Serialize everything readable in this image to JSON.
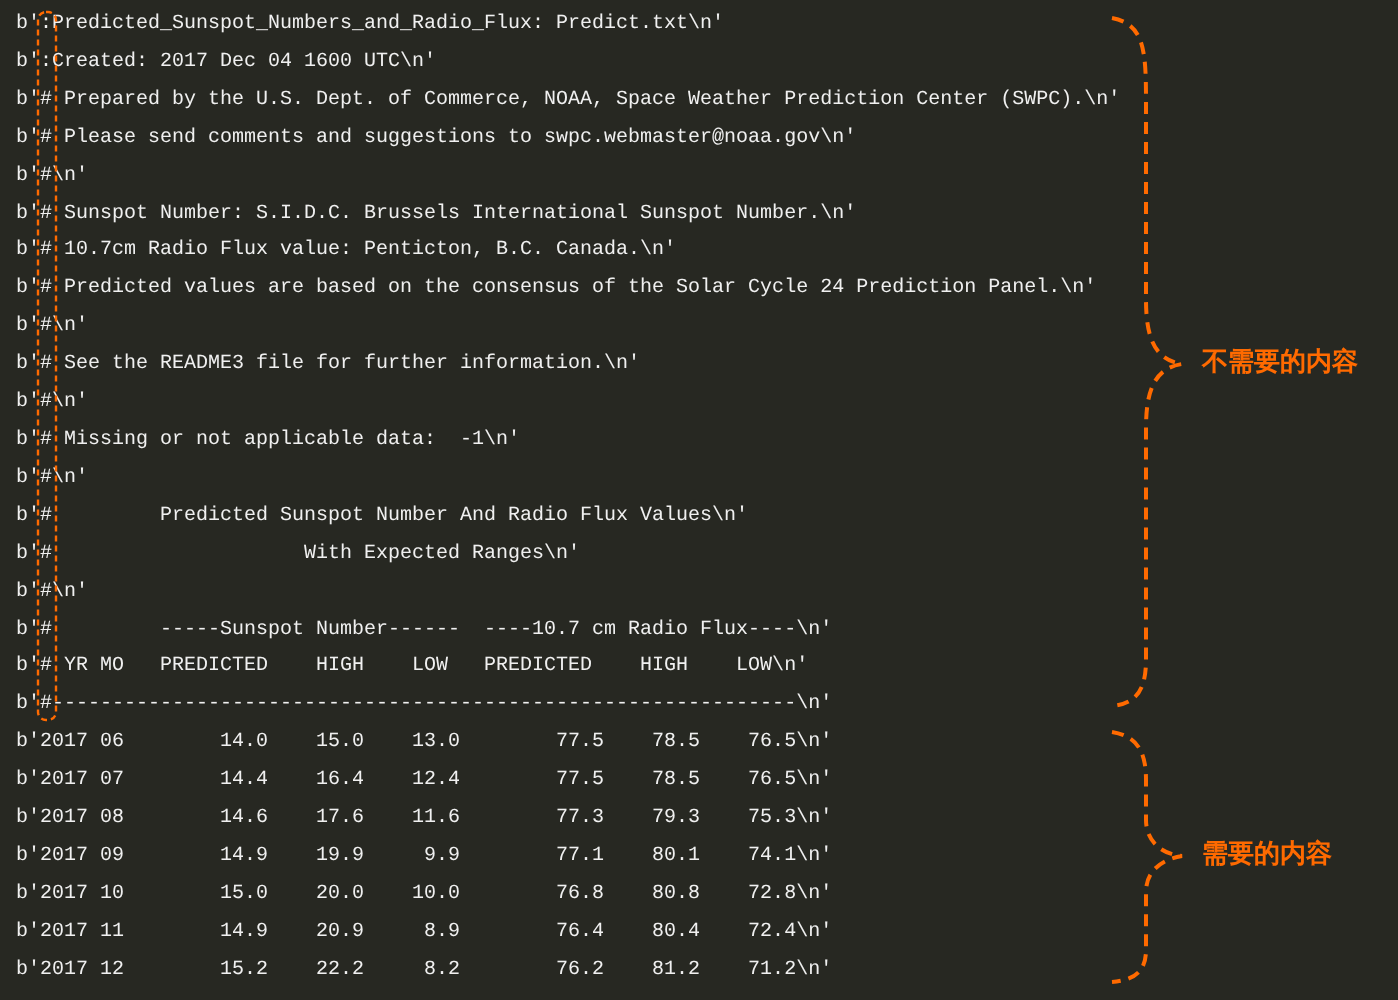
{
  "header_lines": [
    "b':Predicted_Sunspot_Numbers_and_Radio_Flux: Predict.txt\\n'",
    "b':Created: 2017 Dec 04 1600 UTC\\n'",
    "b'# Prepared by the U.S. Dept. of Commerce, NOAA, Space Weather Prediction Center (SWPC).\\n'",
    "b'# Please send comments and suggestions to swpc.webmaster@noaa.gov\\n'",
    "b'#\\n'",
    "b'# Sunspot Number: S.I.D.C. Brussels International Sunspot Number.\\n'",
    "b'# 10.7cm Radio Flux value: Penticton, B.C. Canada.\\n'",
    "b'# Predicted values are based on the consensus of the Solar Cycle 24 Prediction Panel.\\n'",
    "b'#\\n'",
    "b'# See the README3 file for further information.\\n'",
    "b'#\\n'",
    "b'# Missing or not applicable data:  -1\\n'",
    "b'#\\n'",
    "b'#         Predicted Sunspot Number And Radio Flux Values\\n'",
    "b'#                     With Expected Ranges\\n'",
    "b'#\\n'",
    "b'#         -----Sunspot Number------  ----10.7 cm Radio Flux----\\n'",
    "b'# YR MO   PREDICTED    HIGH    LOW   PREDICTED    HIGH    LOW\\n'",
    "b'#--------------------------------------------------------------\\n'"
  ],
  "data_lines": [
    "b'2017 06        14.0    15.0    13.0        77.5    78.5    76.5\\n'",
    "b'2017 07        14.4    16.4    12.4        77.5    78.5    76.5\\n'",
    "b'2017 08        14.6    17.6    11.6        77.3    79.3    75.3\\n'",
    "b'2017 09        14.9    19.9     9.9        77.1    80.1    74.1\\n'",
    "b'2017 10        15.0    20.0    10.0        76.8    80.8    72.8\\n'",
    "b'2017 11        14.9    20.9     8.9        76.4    80.4    72.4\\n'",
    "b'2017 12        15.2    22.2     8.2        76.2    81.2    71.2\\n'"
  ],
  "annotations": [
    {
      "label": "不需要的内容"
    },
    {
      "label": "需要的内容"
    }
  ]
}
